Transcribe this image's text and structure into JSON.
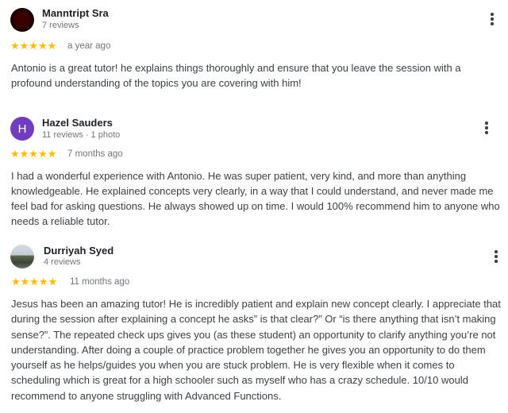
{
  "reviews": [
    {
      "name": "Manntript Sra",
      "meta": "7 reviews",
      "stars": "★★★★★",
      "time": "a year ago",
      "text": "Antonio is a great tutor! he explains things thoroughly and ensure that you leave the session with a profound understanding of the topics you are covering with him!",
      "rating": 5
    },
    {
      "name": "Hazel Sauders",
      "initial": "H",
      "meta": "11 reviews · 1 photo",
      "stars": "★★★★★",
      "time": "7 months ago",
      "text": "I had a wonderful experience with Antonio. He was super patient, very kind, and more than anything knowledgeable. He explained concepts very clearly, in a way that I could understand, and never made me feel bad for asking questions. He always showed up on time. I would 100% recommend him to anyone who needs a reliable tutor.",
      "rating": 5,
      "avatar_color": "#6f3dbd"
    },
    {
      "name": "Durriyah Syed",
      "meta": "4 reviews",
      "stars": "★★★★★",
      "time": "11 months ago",
      "text": "Jesus has been an amazing tutor! He is incredibly patient and explain new concept clearly. I appreciate that during the session after explaining a concept he asks” is that clear?” Or “is there anything that isn’t making sense?”. The repeated check ups gives you (as these student) an opportunity to clarify anything you’re not understanding. After doing a couple of practice problem together he gives you an opportunity to do them yourself as he helps/guides you when you are stuck problem. He is very flexible when it comes to scheduling which is great for a high schooler such as myself who has a crazy schedule. 10/10 would recommend to anyone struggling with Advanced Functions.",
      "rating": 5
    }
  ],
  "colors": {
    "star": "#fbbc04",
    "meta": "#70757a",
    "text": "#3c4043"
  },
  "icons": {
    "menu": "more-vert-icon",
    "star": "star-icon"
  }
}
